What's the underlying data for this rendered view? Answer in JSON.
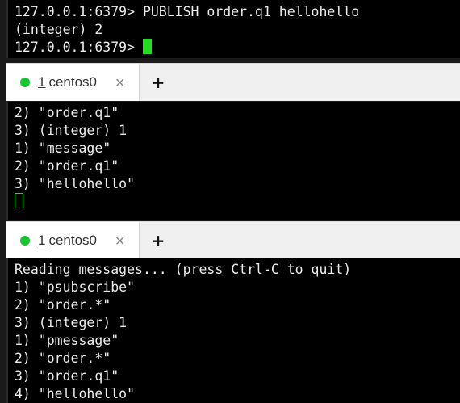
{
  "panes": {
    "top": {
      "lines": [
        "127.0.0.1:6379> PUBLISH order.q1 hellohello",
        "(integer) 2"
      ],
      "prompt": "127.0.0.1:6379> "
    },
    "middle": {
      "tab": {
        "index": "1",
        "name": "centos0",
        "close_glyph": "✕",
        "status_color": "#19c431"
      },
      "new_tab_glyph": "+",
      "lines": [
        "2) \"order.q1\"",
        "3) (integer) 1",
        "1) \"message\"",
        "2) \"order.q1\"",
        "3) \"hellohello\""
      ]
    },
    "bottom": {
      "tab": {
        "index": "1",
        "name": "centos0",
        "close_glyph": "✕",
        "status_color": "#19c431"
      },
      "new_tab_glyph": "+",
      "lines": [
        "Reading messages... (press Ctrl-C to quit)",
        "1) \"psubscribe\"",
        "2) \"order.*\"",
        "3) (integer) 1",
        "1) \"pmessage\"",
        "2) \"order.*\"",
        "3) \"order.q1\"",
        "4) \"hellohello\""
      ]
    }
  },
  "colors": {
    "terminal_bg": "#000000",
    "terminal_fg": "#ececec",
    "cursor": "#22dd22",
    "tab_active_bg": "#ffffff",
    "tabbar_bg": "#f0f0f0"
  }
}
